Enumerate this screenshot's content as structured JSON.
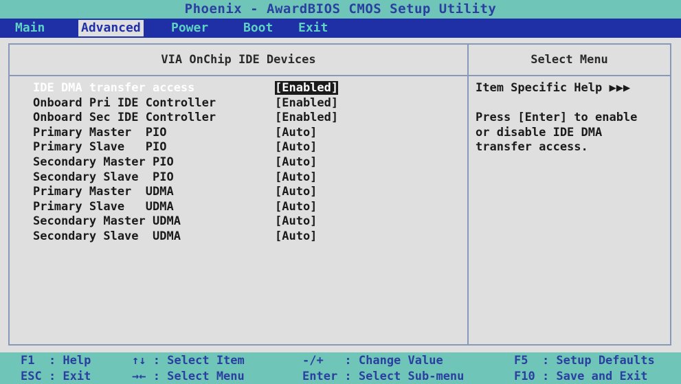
{
  "title": "Phoenix - AwardBIOS CMOS Setup Utility",
  "menu": [
    "Main",
    "Advanced",
    "Power",
    "Boot",
    "Exit"
  ],
  "panel": {
    "left_title": "VIA OnChip IDE Devices",
    "right_title": "Select Menu"
  },
  "settings": [
    {
      "label": "IDE DMA transfer access",
      "value": "[Enabled]"
    },
    {
      "label": "Onboard Pri IDE Controller",
      "value": "[Enabled]"
    },
    {
      "label": "Onboard Sec IDE Controller",
      "value": "[Enabled]"
    },
    {
      "label": "Primary Master  PIO",
      "value": "[Auto]"
    },
    {
      "label": "Primary Slave   PIO",
      "value": "[Auto]"
    },
    {
      "label": "Secondary Master PIO",
      "value": "[Auto]"
    },
    {
      "label": "Secondary Slave  PIO",
      "value": "[Auto]"
    },
    {
      "label": "Primary Master  UDMA",
      "value": "[Auto]"
    },
    {
      "label": "Primary Slave   UDMA",
      "value": "[Auto]"
    },
    {
      "label": "Secondary Master UDMA",
      "value": "[Auto]"
    },
    {
      "label": "Secondary Slave  UDMA",
      "value": "[Auto]"
    }
  ],
  "help": {
    "heading": "Item Specific Help ▶▶▶",
    "lines": [
      "Press [Enter] to enable",
      "or disable IDE DMA",
      "transfer access."
    ]
  },
  "footer": {
    "row1": [
      "F1  : Help",
      "↑↓ : Select Item",
      "-/+   : Change Value",
      "F5  : Setup Defaults"
    ],
    "row2": [
      "ESC : Exit",
      "→← : Select Menu",
      "Enter : Select Sub-menu",
      "F10 : Save and Exit"
    ]
  }
}
